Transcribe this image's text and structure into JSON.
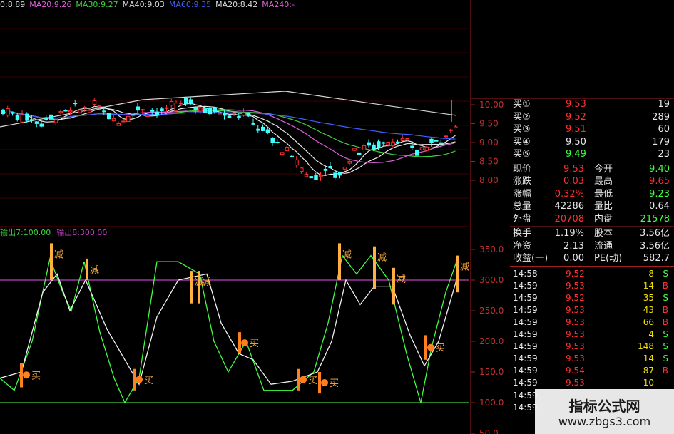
{
  "ma_legend": [
    {
      "text": "0:8.89",
      "color": "#d8d8d8"
    },
    {
      "text": "MA20:9.26",
      "color": "#e060e0"
    },
    {
      "text": "MA30:9.27",
      "color": "#40d040"
    },
    {
      "text": "MA40:9.03",
      "color": "#d8d8d8"
    },
    {
      "text": "MA60:9.35",
      "color": "#4060ff"
    },
    {
      "text": "MA20:8.42",
      "color": "#d8d8d8"
    },
    {
      "text": "MA240:-",
      "color": "#e060e0"
    }
  ],
  "indicator_legend": [
    {
      "text": "输出7:100.00",
      "color": "#40d040"
    },
    {
      "text": "输出8:300.00",
      "color": "#c040c0"
    }
  ],
  "price_axis": [
    "10.00",
    "9.50",
    "9.00",
    "8.50",
    "8.00"
  ],
  "indicator_axis": [
    "350.0",
    "300.0",
    "250.0",
    "200.0",
    "150.0",
    "100.0",
    "50.0"
  ],
  "signals": {
    "buy": "买",
    "sell": "减"
  },
  "colors": {
    "up": "#ff3030",
    "down": "#40ffff",
    "flat": "#e8e8e8",
    "green": "#40ff40",
    "axis": "#a02020"
  },
  "quote": {
    "bids": [
      {
        "label": "买①",
        "price": "9.53",
        "vol": "19",
        "pcolor": "up"
      },
      {
        "label": "买②",
        "price": "9.52",
        "vol": "289",
        "pcolor": "up"
      },
      {
        "label": "买③",
        "price": "9.51",
        "vol": "60",
        "pcolor": "up"
      },
      {
        "label": "买④",
        "price": "9.50",
        "vol": "179",
        "pcolor": "flat"
      },
      {
        "label": "买⑤",
        "price": "9.49",
        "vol": "23",
        "pcolor": "green"
      }
    ],
    "stats": [
      {
        "l1": "现价",
        "v1": "9.53",
        "c1": "up",
        "l2": "今开",
        "v2": "9.40",
        "c2": "green"
      },
      {
        "l1": "涨跌",
        "v1": "0.03",
        "c1": "up",
        "l2": "最高",
        "v2": "9.65",
        "c2": "up"
      },
      {
        "l1": "涨幅",
        "v1": "0.32%",
        "c1": "up",
        "l2": "最低",
        "v2": "9.23",
        "c2": "green"
      },
      {
        "l1": "总量",
        "v1": "42286",
        "c1": "flat",
        "l2": "量比",
        "v2": "0.64",
        "c2": "flat"
      },
      {
        "l1": "外盘",
        "v1": "20708",
        "c1": "up",
        "l2": "内盘",
        "v2": "21578",
        "c2": "green"
      }
    ],
    "finance": [
      {
        "l1": "换手",
        "v1": "1.19%",
        "l2": "股本",
        "v2": "3.56亿"
      },
      {
        "l1": "净资",
        "v1": "2.13",
        "l2": "流通",
        "v2": "3.56亿"
      },
      {
        "l1": "收益(一)",
        "v1": "0.00",
        "l2": "PE(动)",
        "v2": "582.7"
      }
    ],
    "ticks": [
      {
        "time": "14:58",
        "price": "9.52",
        "vol": "8",
        "side": "S"
      },
      {
        "time": "14:59",
        "price": "9.53",
        "vol": "14",
        "side": "B"
      },
      {
        "time": "14:59",
        "price": "9.52",
        "vol": "35",
        "side": "S"
      },
      {
        "time": "14:59",
        "price": "9.53",
        "vol": "43",
        "side": "B"
      },
      {
        "time": "14:59",
        "price": "9.53",
        "vol": "66",
        "side": "B"
      },
      {
        "time": "14:59",
        "price": "9.53",
        "vol": "4",
        "side": "S"
      },
      {
        "time": "14:59",
        "price": "9.53",
        "vol": "148",
        "side": "S"
      },
      {
        "time": "14:59",
        "price": "9.53",
        "vol": "14",
        "side": "S"
      },
      {
        "time": "14:59",
        "price": "9.54",
        "vol": "87",
        "side": "B"
      },
      {
        "time": "14:59",
        "price": "9.53",
        "vol": "10",
        "side": ""
      },
      {
        "time": "14:59",
        "price": "",
        "vol": "",
        "side": ""
      },
      {
        "time": "14:59",
        "price": "",
        "vol": "",
        "side": ""
      }
    ]
  },
  "watermark": {
    "title": "指标公式网",
    "url": "www.zbgs3.com"
  }
}
